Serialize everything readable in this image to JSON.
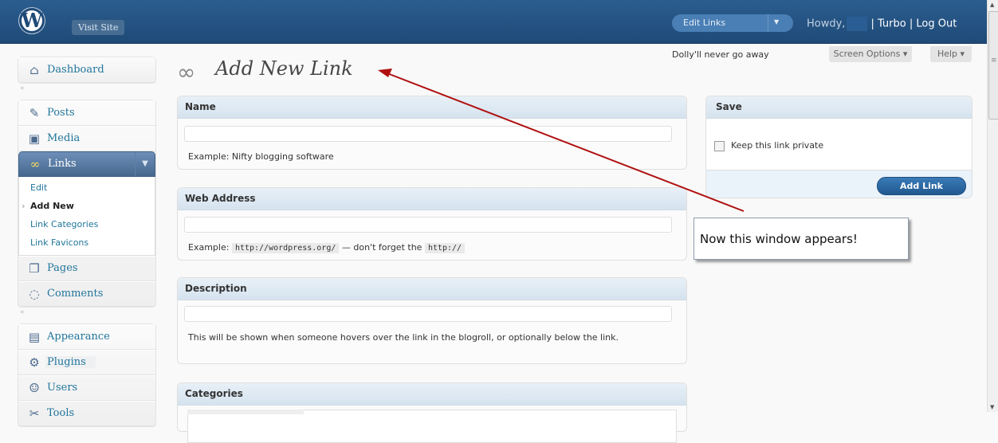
{
  "header": {
    "logo": "W",
    "visit_site": "Visit Site",
    "favorite_actions": {
      "selected": "Edit Links"
    },
    "howdy": "Howdy,",
    "links": [
      "| Turbo",
      "| Log Out"
    ]
  },
  "menu": {
    "dashboard": "Dashboard",
    "posts": "Posts",
    "media": "Media",
    "links": "Links",
    "links_submenu": [
      "Edit",
      "Add New",
      "Link Categories",
      "Link Favicons"
    ],
    "pages": "Pages",
    "comments": "Comments",
    "appearance": "Appearance",
    "plugins": "Plugins",
    "users": "Users",
    "tools": "Tools",
    "separator_glyph": "«"
  },
  "top_right": {
    "dolly": "Dolly'll never go away",
    "screen_options": "Screen Options ▾",
    "help": "Help ▾"
  },
  "page": {
    "title": "Add New Link"
  },
  "boxes": {
    "name": {
      "title": "Name",
      "value": "",
      "help": "Example: Nifty blogging software"
    },
    "web_address": {
      "title": "Web Address",
      "value": "",
      "help_prefix": "Example:",
      "help_code1": "http://wordpress.org/",
      "help_middle": "— don't forget the",
      "help_code2": "http://"
    },
    "description": {
      "title": "Description",
      "value": "",
      "help": "This will be shown when someone hovers over the link in the blogroll, or optionally below the link."
    },
    "categories": {
      "title": "Categories"
    }
  },
  "save_box": {
    "title": "Save",
    "private_label": "Keep this link private",
    "private_checked": false,
    "add_button": "Add Link"
  },
  "callout": {
    "text": "Now this window appears!"
  },
  "colors": {
    "header": "#1f4a77",
    "link": "#21759b",
    "arrow": "#b01010",
    "active_menu": "#46688f"
  }
}
